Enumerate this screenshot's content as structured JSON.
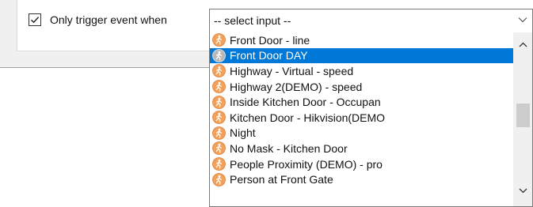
{
  "trigger": {
    "label": "Only trigger event when",
    "checked": true
  },
  "select": {
    "value": "-- select input --",
    "chevron_icon": "chevron-down-icon"
  },
  "dropdown": {
    "item_icon": "person-running-icon",
    "selected_index": 1,
    "items": [
      "Front Door - line",
      "Front Door DAY",
      "Highway - Virtual - speed",
      "Highway 2(DEMO) - speed",
      "Inside Kitchen Door - Occupan",
      "Kitchen Door - Hikvision(DEMO",
      "Night",
      "No Mask - Kitchen Door",
      "People Proximity (DEMO) - pro",
      "Person at Front Gate"
    ]
  },
  "colors": {
    "selection": "#0078d7",
    "icon_orange": "#f2a05a"
  }
}
